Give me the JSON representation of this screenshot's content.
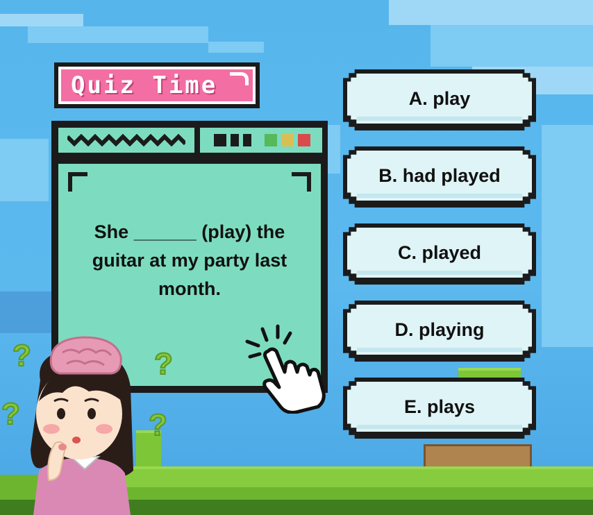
{
  "title": {
    "text": "Quiz Time"
  },
  "question": {
    "text": "She ______ (play) the guitar at my party last month."
  },
  "options": [
    {
      "label": "A. play"
    },
    {
      "label": "B. had played"
    },
    {
      "label": "C. played"
    },
    {
      "label": "D. playing"
    },
    {
      "label": "E. plays"
    }
  ],
  "window_bar": {
    "status_colors": [
      "#56b95a",
      "#d9be54",
      "#db4a4a"
    ]
  },
  "colors": {
    "title_badge": "#f36ea2",
    "window": "#7ddcbf",
    "option_fill": "#dff4f7",
    "sky": "#56b6ec",
    "grass": "#6db52f"
  },
  "icons": [
    "pointing-hand-cursor-icon",
    "question-mark-icon",
    "thinking-girl-character"
  ]
}
